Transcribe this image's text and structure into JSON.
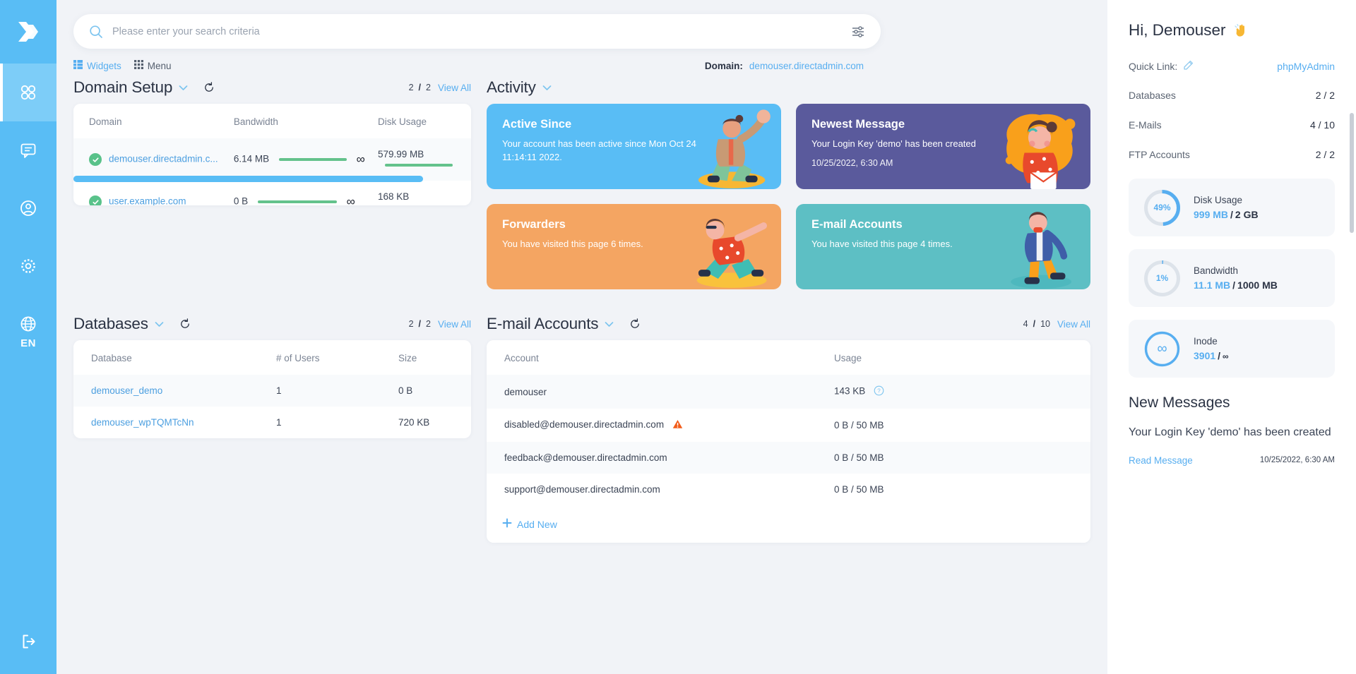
{
  "sidebar": {
    "logo_icon": "directadmin-chevrons-logo",
    "items": [
      {
        "name": "dashboard",
        "icon": "grid-circles-icon",
        "active": true
      },
      {
        "name": "messages",
        "icon": "message-icon",
        "active": false
      },
      {
        "name": "account",
        "icon": "user-circle-icon",
        "active": false
      },
      {
        "name": "settings",
        "icon": "gear-icon",
        "active": false
      },
      {
        "name": "language",
        "icon": "globe-icon",
        "active": false
      }
    ],
    "language_label": "EN",
    "logout_icon": "logout-icon"
  },
  "search": {
    "placeholder": "Please enter your search criteria",
    "value": ""
  },
  "subbar": {
    "widgets_label": "Widgets",
    "menu_label": "Menu",
    "domain_label": "Domain:",
    "domain_value": "demouser.directadmin.com"
  },
  "domain_setup": {
    "title": "Domain Setup",
    "count_current": "2",
    "count_total": "2",
    "view_all": "View All",
    "columns": [
      "Domain",
      "Bandwidth",
      "Disk Usage"
    ],
    "rows": [
      {
        "domain": "demouser.directadmin.c...",
        "bandwidth": "6.14 MB",
        "bandwidth_limit": "∞",
        "disk": "579.99 MB"
      },
      {
        "domain": "user.example.com",
        "bandwidth": "0 B",
        "bandwidth_limit": "∞",
        "disk": "168 KB"
      }
    ]
  },
  "activity": {
    "title": "Activity",
    "tiles": [
      {
        "title": "Active Since",
        "text": "Your account has been active since Mon Oct 24 11:14:11 2022.",
        "stamp": "",
        "color": "#59bdf5"
      },
      {
        "title": "Newest Message",
        "text": "Your Login Key 'demo' has been created",
        "stamp": "10/25/2022, 6:30 AM",
        "color": "#5a5a9c"
      },
      {
        "title": "Forwarders",
        "text": "You have visited this page 6 times.",
        "stamp": "",
        "color": "#f4a562"
      },
      {
        "title": "E-mail Accounts",
        "text": "You have visited this page 4 times.",
        "stamp": "",
        "color": "#5dbfc4"
      }
    ]
  },
  "databases": {
    "title": "Databases",
    "count_current": "2",
    "count_total": "2",
    "view_all": "View All",
    "columns": [
      "Database",
      "# of Users",
      "Size"
    ],
    "rows": [
      {
        "name": "demouser_demo",
        "users": "1",
        "size": "0 B"
      },
      {
        "name": "demouser_wpTQMTcNn",
        "users": "1",
        "size": "720 KB"
      }
    ]
  },
  "email_accounts": {
    "title": "E-mail Accounts",
    "count_current": "4",
    "count_total": "10",
    "view_all": "View All",
    "columns": [
      "Account",
      "Usage"
    ],
    "rows": [
      {
        "account": "demouser",
        "usage": "143 KB",
        "warn": false,
        "help": true
      },
      {
        "account": "disabled@demouser.directadmin.com",
        "usage": "0 B / 50 MB",
        "warn": true,
        "help": false
      },
      {
        "account": "feedback@demouser.directadmin.com",
        "usage": "0 B / 50 MB",
        "warn": false,
        "help": false
      },
      {
        "account": "support@demouser.directadmin.com",
        "usage": "0 B / 50 MB",
        "warn": false,
        "help": false
      }
    ],
    "add_new_label": "Add New"
  },
  "right_panel": {
    "greeting": "Hi, Demouser",
    "wave_icon": "waving-hand-icon",
    "quick_link_label": "Quick Link:",
    "quick_link_value": "phpMyAdmin",
    "stats": [
      {
        "label": "Databases",
        "value": "2 / 2"
      },
      {
        "label": "E-Mails",
        "value": "4 / 10"
      },
      {
        "label": "FTP Accounts",
        "value": "2 / 2"
      }
    ],
    "gauges": [
      {
        "label": "Disk Usage",
        "percent": "49%",
        "percent_num": 49,
        "used": "999 MB",
        "limit": "2 GB",
        "infinite": false
      },
      {
        "label": "Bandwidth",
        "percent": "1%",
        "percent_num": 1,
        "used": "11.1 MB",
        "limit": "1000 MB",
        "infinite": false
      },
      {
        "label": "Inode",
        "percent": "∞",
        "percent_num": 100,
        "used": "3901",
        "limit": "∞",
        "infinite": true
      }
    ],
    "messages_title": "New Messages",
    "message_text": "Your Login Key 'demo' has been created",
    "read_label": "Read Message",
    "message_time": "10/25/2022, 6:30 AM"
  },
  "colors": {
    "brand_blue": "#59bdf5",
    "link_blue": "#57aef0",
    "green": "#64c28c",
    "orange": "#f4a562",
    "purple": "#5a5a9c",
    "teal": "#5dbfc4",
    "bg": "#f1f3f7"
  }
}
